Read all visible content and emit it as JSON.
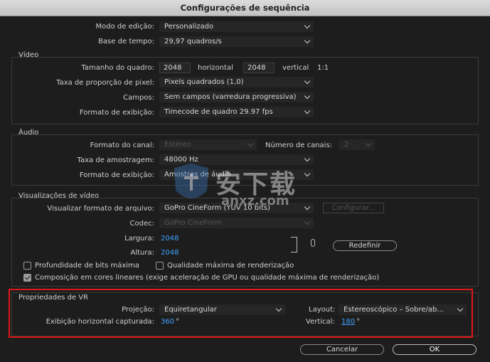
{
  "window": {
    "title": "Configurações de sequência"
  },
  "top": {
    "edit_mode_label": "Modo de edição:",
    "edit_mode_value": "Personalizado",
    "timebase_label": "Base de tempo:",
    "timebase_value": "29,97  quadros/s"
  },
  "video": {
    "section_title": "Vídeo",
    "frame_size_label": "Tamanho do quadro:",
    "frame_width": "2048",
    "horizontal_label": "horizontal",
    "frame_height": "2048",
    "vertical_label": "vertical",
    "ratio": "1:1",
    "pixel_aspect_label": "Taxa de proporção de pixel:",
    "pixel_aspect_value": "Pixels quadrados (1,0)",
    "fields_label": "Campos:",
    "fields_value": "Sem campos (varredura progressiva)",
    "display_format_label": "Formato de exibição:",
    "display_format_value": "Timecode de quadro 29.97 fps"
  },
  "audio": {
    "section_title": "Áudio",
    "channel_format_label": "Formato do canal:",
    "channel_format_value": "Estéreo",
    "num_channels_label": "Número de canais:",
    "num_channels_value": "2",
    "sample_rate_label": "Taxa de amostragem:",
    "sample_rate_value": "48000 Hz",
    "display_format_label": "Formato de exibição:",
    "display_format_value": "Amostras de áudio"
  },
  "previews": {
    "section_title": "Visualizações de vídeo",
    "file_format_label": "Visualizar formato de arquivo:",
    "file_format_value": "GoPro CineForm (YUV 10 bits)",
    "configure_button": "Configurar...",
    "codec_label": "Codec:",
    "codec_value": "GoPro CineForm",
    "width_label": "Largura:",
    "width_value": "2048",
    "height_label": "Altura:",
    "height_value": "2048",
    "reset_button": "Redefinir"
  },
  "options": {
    "max_bit_depth": "Profundidade de bits máxima",
    "max_render_quality": "Qualidade máxima de renderização",
    "linear_color": "Composição em cores lineares (exige aceleração de GPU ou qualidade máxima de renderização)"
  },
  "vr": {
    "section_title": "Propriedades de VR",
    "projection_label": "Projeção:",
    "projection_value": "Equiretangular",
    "layout_label": "Layout:",
    "layout_value": "Estereoscópico – Sobre/ab...",
    "horizontal_label": "Exibição horizontal capturada:",
    "horizontal_value": "360",
    "vertical_label": "Vertical:",
    "vertical_value": "180",
    "degree": "°"
  },
  "buttons": {
    "cancel": "Cancelar",
    "ok": "OK"
  },
  "watermark": {
    "text": "安下载",
    "sub": "anxz.com"
  }
}
